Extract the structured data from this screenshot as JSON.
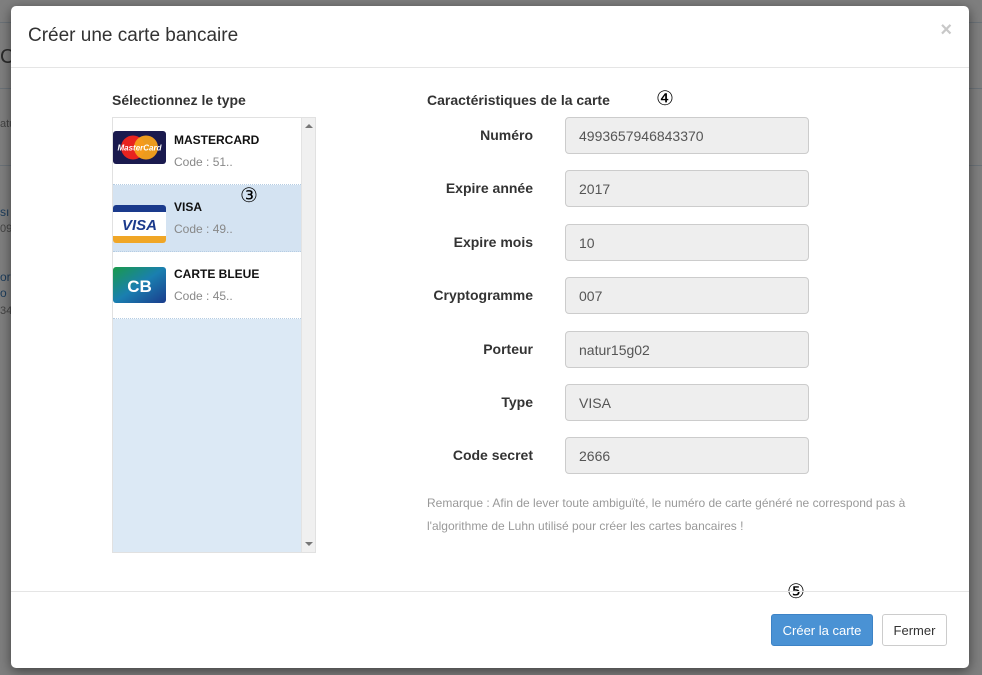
{
  "modal": {
    "title": "Créer une carte bancaire",
    "close_label": "×"
  },
  "type_section": {
    "title": "Sélectionnez le type",
    "cards": [
      {
        "name": "MASTERCARD",
        "code": "Code : 51..",
        "logo": "mastercard-logo",
        "logo_text": "MasterCard",
        "selected": false
      },
      {
        "name": "VISA",
        "code": "Code : 49..",
        "logo": "visa-logo",
        "logo_text": "VISA",
        "selected": true
      },
      {
        "name": "CARTE BLEUE",
        "code": "Code : 45..",
        "logo": "carte-bleue-logo",
        "logo_text": "CB",
        "selected": false
      }
    ]
  },
  "details": {
    "title": "Caractéristiques de la carte",
    "fields": [
      {
        "label": "Numéro",
        "value": "4993657946843370"
      },
      {
        "label": "Expire année",
        "value": "2017"
      },
      {
        "label": "Expire mois",
        "value": "10"
      },
      {
        "label": "Cryptogramme",
        "value": "007"
      },
      {
        "label": "Porteur",
        "value": "natur15g02"
      },
      {
        "label": "Type",
        "value": "VISA"
      },
      {
        "label": "Code secret",
        "value": "2666"
      }
    ],
    "remark": "Remarque : Afin de lever toute ambiguïté, le numéro de carte généré ne correspond pas à l'algorithme de Luhn utilisé pour créer les cartes bancaires !"
  },
  "annotations": {
    "step3": "③",
    "step4": "④",
    "step5": "⑤"
  },
  "footer": {
    "create_label": "Créer la carte",
    "close_label": "Fermer"
  },
  "background": {
    "fragments": [
      "C",
      "atu",
      "sı",
      "09",
      "or",
      "o",
      "34"
    ]
  },
  "colors": {
    "primary_button": "#4a92d4",
    "selected_row": "#d4e3f2",
    "list_background": "#dce9f5"
  }
}
